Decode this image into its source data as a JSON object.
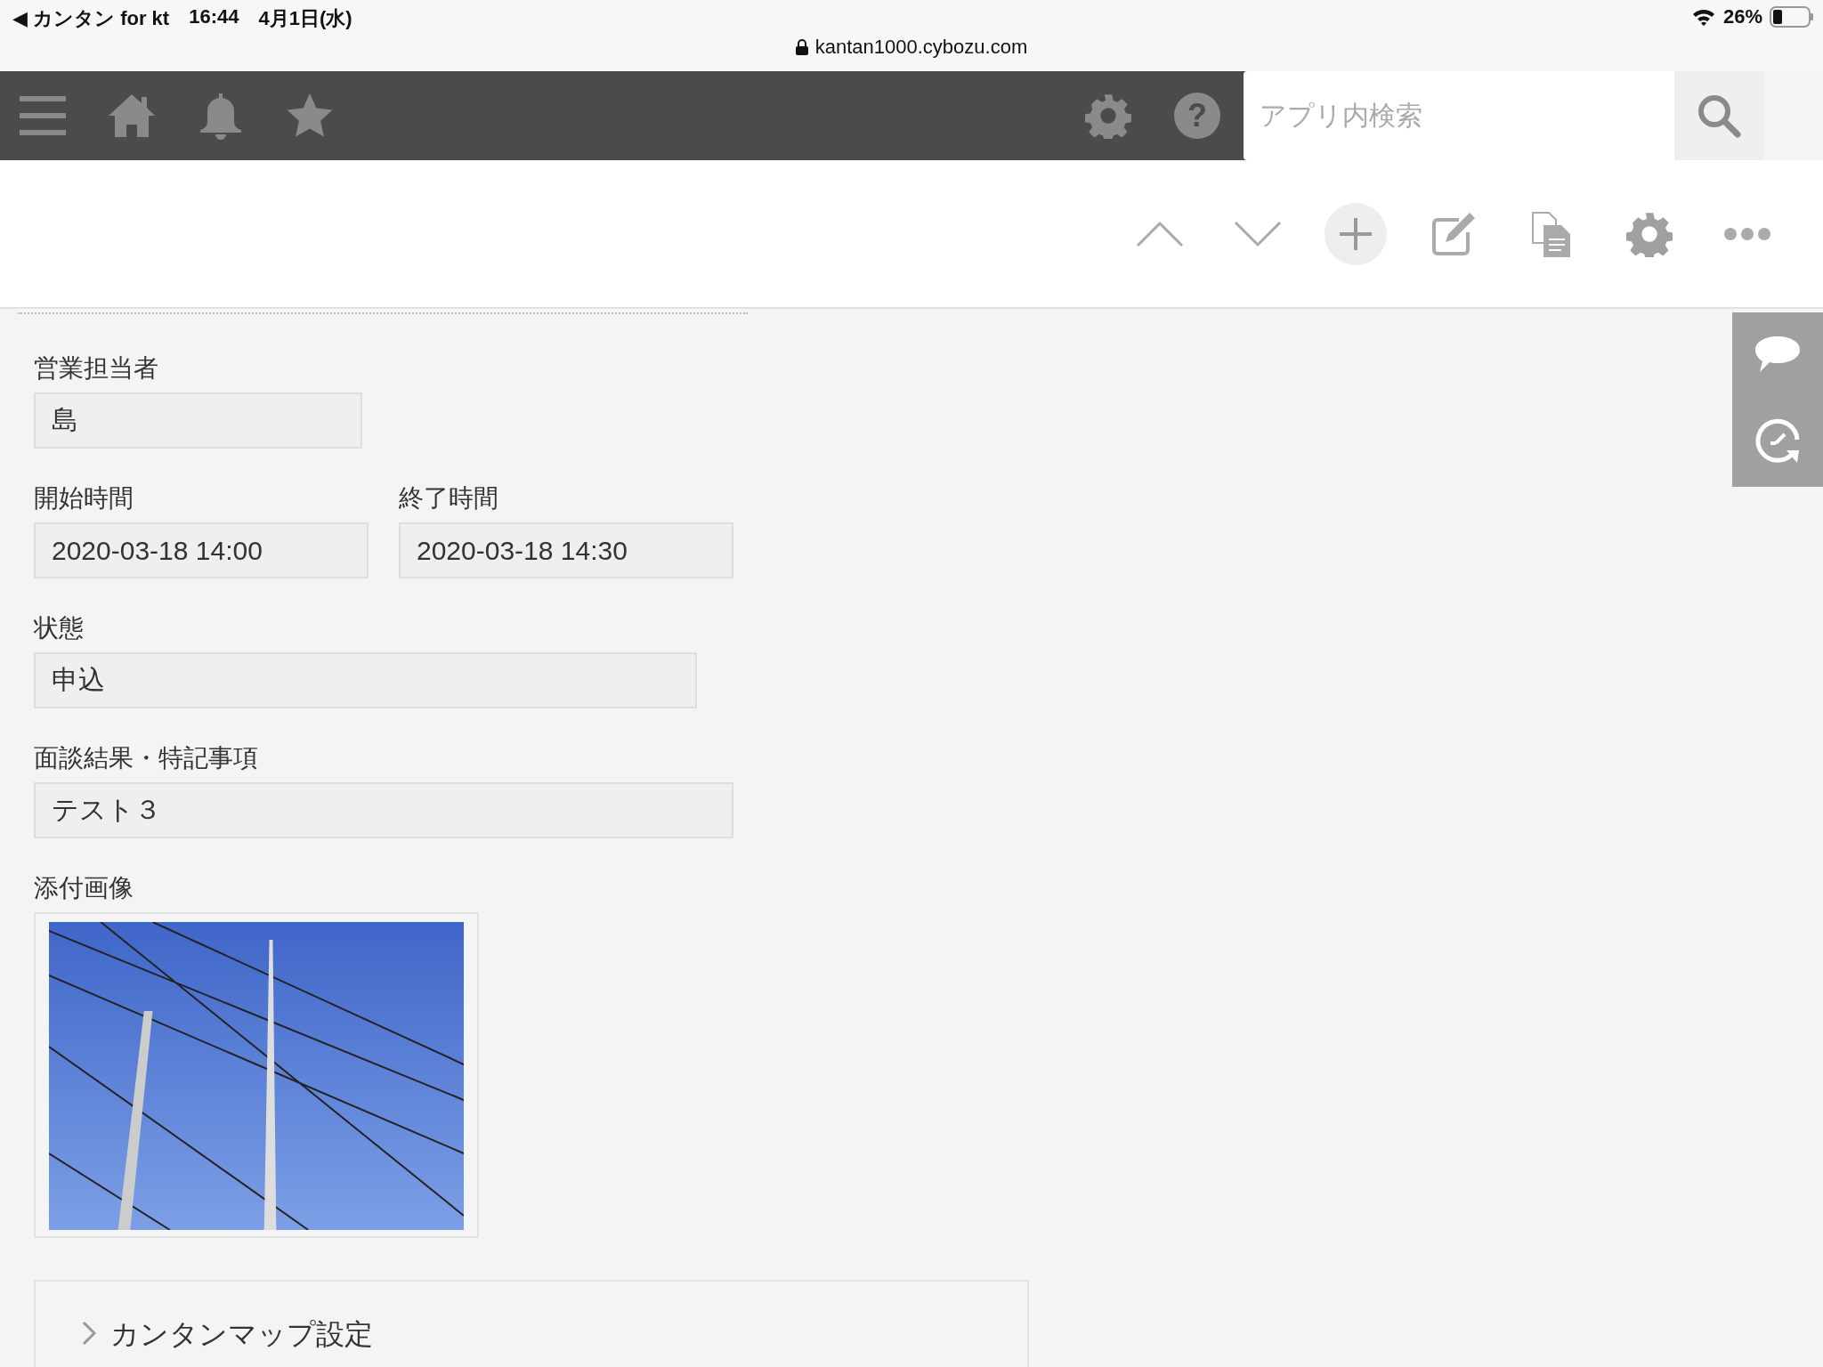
{
  "status_bar": {
    "back_app": "◀ カンタン for kt",
    "time": "16:44",
    "date": "4月1日(水)",
    "battery": "26%",
    "url": "kantan1000.cybozu.com"
  },
  "header": {
    "help_glyph": "?",
    "search": {
      "placeholder": "アプリ内検索"
    }
  },
  "rows": [
    [
      {
        "kind": "short",
        "label": "営業担当者",
        "value": "島"
      }
    ],
    [
      {
        "kind": "half",
        "label": "開始時間",
        "value": "2020-03-18 14:00"
      },
      {
        "kind": "half",
        "label": "終了時間",
        "value": "2020-03-18 14:30"
      }
    ],
    [
      {
        "kind": "wide",
        "label": "状態",
        "value": "申込"
      }
    ],
    [
      {
        "kind": "full",
        "label": "面談結果・特記事項",
        "value": "テスト３"
      }
    ]
  ],
  "attachment": {
    "label": "添付画像"
  },
  "section": {
    "title": "カンタンマップ設定",
    "expanded": false
  }
}
